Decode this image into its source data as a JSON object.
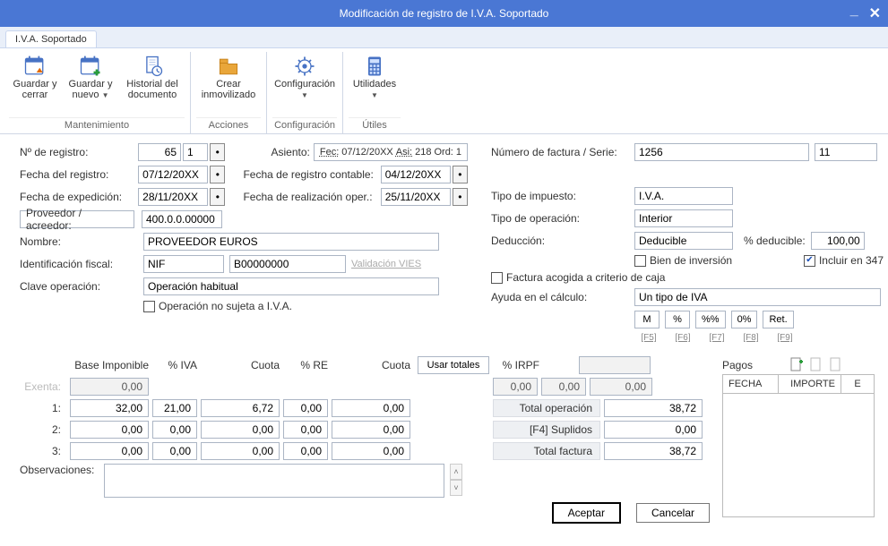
{
  "window": {
    "title": "Modificación de registro de I.V.A. Soportado"
  },
  "tab": "I.V.A. Soportado",
  "ribbon": {
    "mantenimiento": {
      "label": "Mantenimiento",
      "guardar_cerrar": "Guardar y cerrar",
      "guardar_nuevo": "Guardar y nuevo",
      "historial": "Historial del documento"
    },
    "acciones": {
      "label": "Acciones",
      "crear_inm": "Crear inmovilizado"
    },
    "configuracion": {
      "label": "Configuración",
      "config": "Configuración"
    },
    "utiles": {
      "label": "Útiles",
      "utilidades": "Utilidades"
    }
  },
  "left": {
    "n_registro_lbl": "Nº de registro:",
    "n_registro": "65",
    "n_registro_seq": "1",
    "fecha_registro_lbl": "Fecha del registro:",
    "fecha_registro": "07/12/20XX",
    "fecha_exped_lbl": "Fecha de expedición:",
    "fecha_exped": "28/11/20XX",
    "asiento_lbl": "Asiento:",
    "asiento_fec": "Fec:",
    "asiento_fec_val": "07/12/20XX",
    "asiento_asi": "Asi:",
    "asiento_asi_val": "218",
    "asiento_ord": "Ord:",
    "asiento_ord_val": "1",
    "fecha_reg_cont_lbl": "Fecha de registro contable:",
    "fecha_reg_cont": "04/12/20XX",
    "fecha_real_oper_lbl": "Fecha de realización oper.:",
    "fecha_real_oper": "25/11/20XX",
    "proveedor_btn": "Proveedor / acreedor:",
    "proveedor_val": "400.0.0.00000",
    "nombre_lbl": "Nombre:",
    "nombre_val": "PROVEEDOR EUROS",
    "ident_fiscal_lbl": "Identificación fiscal:",
    "ident_fiscal_tipo": "NIF",
    "ident_fiscal_val": "B00000000",
    "validacion_vies": "Validación VIES",
    "clave_oper_lbl": "Clave operación:",
    "clave_oper_val": "Operación habitual",
    "op_no_sujeta": "Operación no sujeta a I.V.A."
  },
  "right": {
    "num_factura_lbl": "Número de factura / Serie:",
    "num_factura": "1256",
    "serie": "11",
    "tipo_impuesto_lbl": "Tipo de impuesto:",
    "tipo_impuesto": "I.V.A.",
    "tipo_oper_lbl": "Tipo de operación:",
    "tipo_oper": "Interior",
    "deduccion_lbl": "Deducción:",
    "deduccion": "Deducible",
    "pct_deducible_lbl": "% deducible:",
    "pct_deducible": "100,00",
    "bien_inversion": "Bien de inversión",
    "incluir_347": "Incluir en 347",
    "factura_caja": "Factura acogida a criterio de caja",
    "ayuda_calc_lbl": "Ayuda en el cálculo:",
    "ayuda_calc_val": "Un tipo de IVA",
    "calcbtns": [
      "M",
      "%",
      "%%",
      "0%",
      "Ret."
    ],
    "calchints": [
      "[F5]",
      "[F6]",
      "[F7]",
      "[F8]",
      "[F9]"
    ]
  },
  "grid": {
    "headers": {
      "base": "Base Imponible",
      "pctiva": "% IVA",
      "cuota": "Cuota",
      "pctre": "% RE",
      "cuota2": "Cuota",
      "usar_tot": "Usar totales",
      "pctirpf": "% IRPF"
    },
    "exenta_lbl": "Exenta:",
    "row_lbls": [
      "1:",
      "2:",
      "3:"
    ],
    "exenta": "0,00",
    "rows": [
      {
        "base": "32,00",
        "pctiva": "21,00",
        "cuota": "6,72",
        "pctre": "0,00",
        "cuota2": "0,00"
      },
      {
        "base": "0,00",
        "pctiva": "0,00",
        "cuota": "0,00",
        "pctre": "0,00",
        "cuota2": "0,00"
      },
      {
        "base": "0,00",
        "pctiva": "0,00",
        "cuota": "0,00",
        "pctre": "0,00",
        "cuota2": "0,00"
      }
    ],
    "irpf_row": {
      "a": "0,00",
      "b": "0,00",
      "c": "0,00"
    },
    "totals": {
      "total_oper_lbl": "Total operación",
      "total_oper": "38,72",
      "suplidos_lbl": "[F4] Suplidos",
      "suplidos": "0,00",
      "total_fact_lbl": "Total factura",
      "total_fact": "38,72"
    },
    "obs_lbl": "Observaciones:",
    "pagos_lbl": "Pagos",
    "pagos_cols": {
      "fecha": "FECHA",
      "importe": "IMPORTE",
      "e": "E"
    }
  },
  "buttons": {
    "aceptar": "Aceptar",
    "cancelar": "Cancelar"
  }
}
